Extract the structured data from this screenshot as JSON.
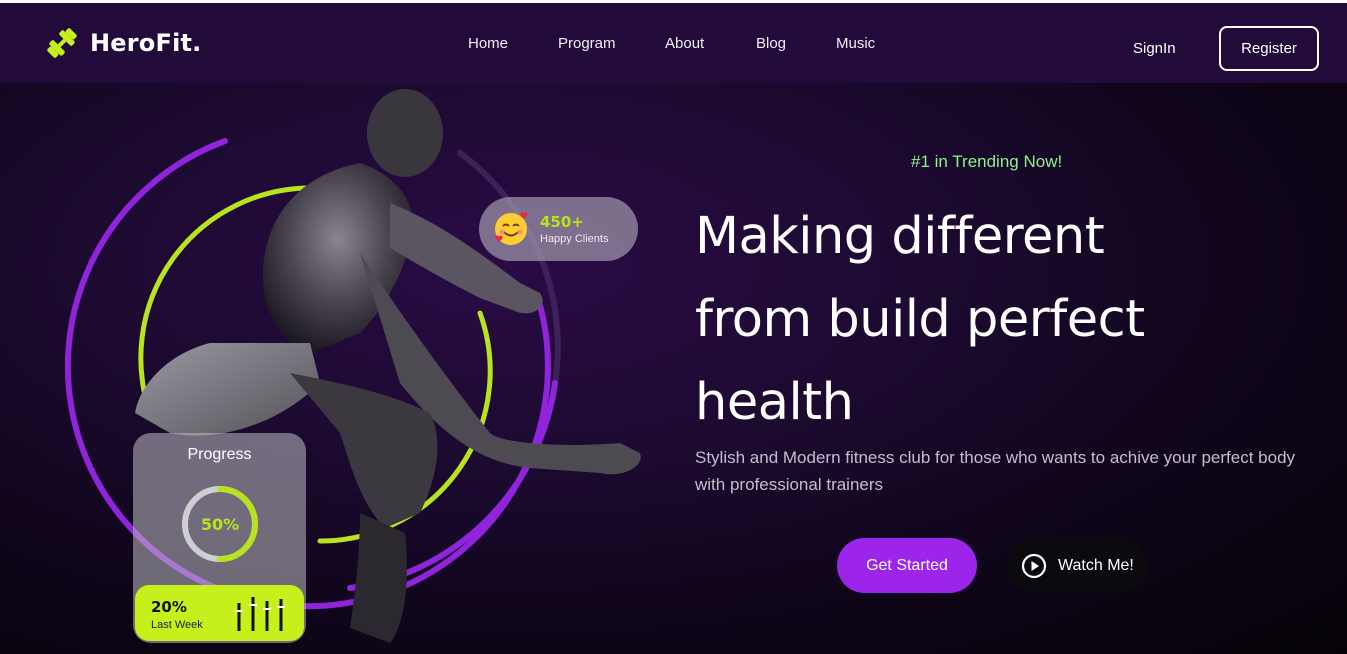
{
  "brand": {
    "name": "HeroFit.",
    "logo_icon": "dumbbell-icon",
    "accent": "#b7e31f"
  },
  "nav": {
    "links": [
      "Home",
      "Program",
      "About",
      "Blog",
      "Music"
    ],
    "signin_label": "SignIn",
    "register_label": "Register"
  },
  "hero": {
    "badge": "#1 in Trending Now!",
    "headline_lines": [
      "Making different",
      "from build perfect",
      "health"
    ],
    "subtitle": "Stylish and Modern fitness club for those who wants to achive your perfect body with professional trainers",
    "cta_primary": "Get Started",
    "cta_secondary": "Watch Me!",
    "primary_color": "#9d25ea"
  },
  "stats": {
    "clients_count": "450+",
    "clients_label": "Happy Clients",
    "clients_icon": "smiling-face-with-hearts-icon",
    "progress_title": "Progress",
    "progress_value": "50%",
    "progress_fraction": 0.5,
    "week_value": "20%",
    "week_label": "Last Week"
  }
}
